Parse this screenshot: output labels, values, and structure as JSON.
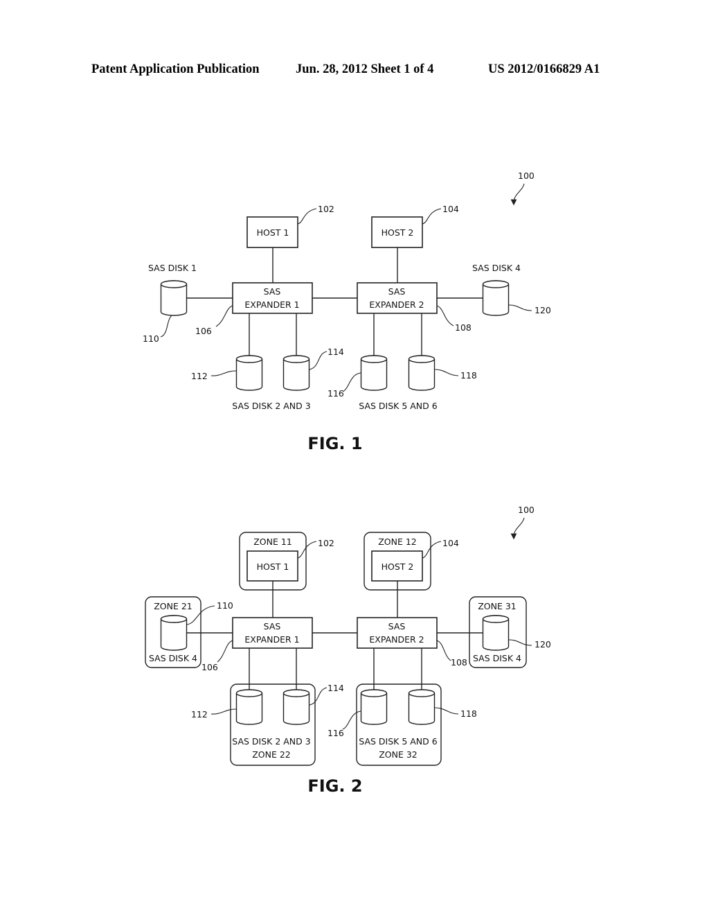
{
  "header": {
    "left": "Patent Application Publication",
    "middle": "Jun. 28, 2012  Sheet 1 of 4",
    "right": "US 2012/0166829 A1"
  },
  "figures": [
    {
      "caption": "FIG. 1",
      "system_ref": "100",
      "hosts": [
        {
          "label": "HOST 1",
          "ref": "102"
        },
        {
          "label": "HOST 2",
          "ref": "104"
        }
      ],
      "expanders": [
        {
          "line1": "SAS",
          "line2": "EXPANDER 1",
          "ref": "106"
        },
        {
          "line1": "SAS",
          "line2": "EXPANDER 2",
          "ref": "108"
        }
      ],
      "side_disks": [
        {
          "label": "SAS DISK 1",
          "ref": "110"
        },
        {
          "label": "SAS DISK 4",
          "ref": "120"
        }
      ],
      "bottom_disks": [
        {
          "ref": "112"
        },
        {
          "ref": "114"
        },
        {
          "ref": "116"
        },
        {
          "ref": "118"
        }
      ],
      "bottom_groups": [
        {
          "label": "SAS DISK 2 AND 3"
        },
        {
          "label": "SAS DISK 5 AND 6"
        }
      ]
    },
    {
      "caption": "FIG. 2",
      "system_ref": "100",
      "hosts": [
        {
          "label": "HOST 1",
          "ref": "102",
          "zone": "ZONE 11"
        },
        {
          "label": "HOST 2",
          "ref": "104",
          "zone": "ZONE 12"
        }
      ],
      "expanders": [
        {
          "line1": "SAS",
          "line2": "EXPANDER 1",
          "ref": "106"
        },
        {
          "line1": "SAS",
          "line2": "EXPANDER 2",
          "ref": "108"
        }
      ],
      "side_disks": [
        {
          "label": "SAS DISK 4",
          "ref": "110",
          "zone": "ZONE 21"
        },
        {
          "label": "SAS DISK 4",
          "ref": "120",
          "zone": "ZONE 31"
        }
      ],
      "bottom_disks": [
        {
          "ref": "112"
        },
        {
          "ref": "114"
        },
        {
          "ref": "116"
        },
        {
          "ref": "118"
        }
      ],
      "bottom_groups": [
        {
          "label": "SAS DISK 2 AND 3",
          "zone": "ZONE 22"
        },
        {
          "label": "SAS DISK 5 AND 6",
          "zone": "ZONE 32"
        }
      ]
    }
  ]
}
